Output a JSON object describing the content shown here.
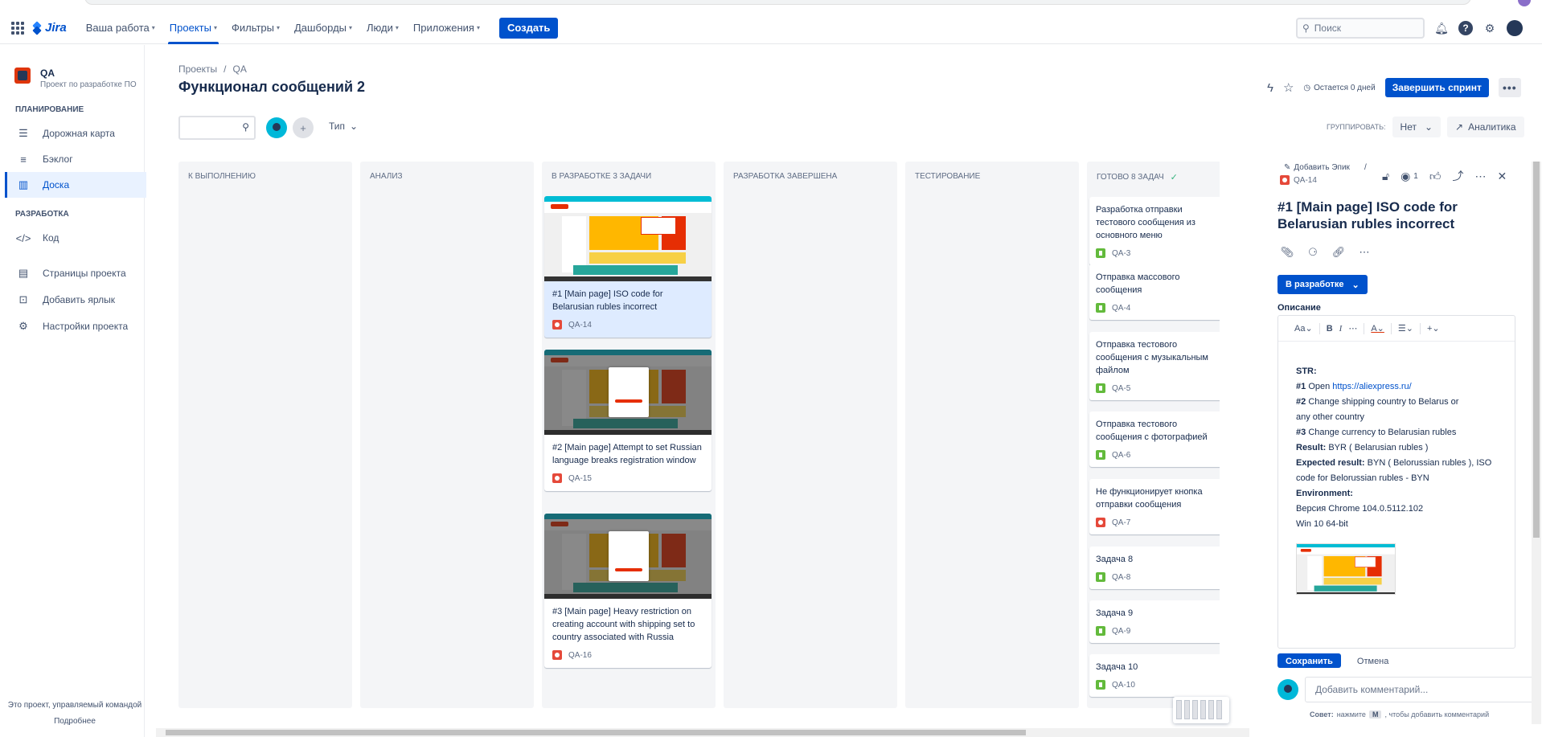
{
  "nav": {
    "logo": "Jira",
    "items": [
      {
        "label": "Ваша работа"
      },
      {
        "label": "Проекты"
      },
      {
        "label": "Фильтры"
      },
      {
        "label": "Дашборды"
      },
      {
        "label": "Люди"
      },
      {
        "label": "Приложения"
      }
    ],
    "create": "Создать",
    "search_placeholder": "Поиск"
  },
  "sidebar": {
    "project_name": "QA",
    "project_sub": "Проект по разработке ПО",
    "section_planning": "ПЛАНИРОВАНИЕ",
    "items": [
      {
        "label": "Дорожная карта"
      },
      {
        "label": "Бэклог"
      },
      {
        "label": "Доска"
      }
    ],
    "section_dev": "РАЗРАБОТКА",
    "code": "Код",
    "pages": "Страницы проекта",
    "add_shortcut": "Добавить ярлык",
    "settings": "Настройки проекта",
    "footer_note": "Это проект, управляемый командой",
    "footer_link": "Подробнее"
  },
  "header": {
    "breadcrumb_projects": "Проекты",
    "breadcrumb_sep": "/",
    "breadcrumb_qa": "QA",
    "title": "Функционал сообщений 2",
    "remaining": "Остается 0 дней",
    "complete_sprint": "Завершить спринт",
    "more": "•••"
  },
  "filters": {
    "type": "Тип",
    "groupby_label": "ГРУППИРОВАТЬ:",
    "groupby_value": "Нет",
    "analytics": "Аналитика"
  },
  "columns": [
    {
      "title": "К выполнению"
    },
    {
      "title": "Анализ"
    },
    {
      "title": "В разработке 3 задачи"
    },
    {
      "title": "Разработка завершена"
    },
    {
      "title": "Тестирование"
    },
    {
      "title": "Готово 8 задач"
    }
  ],
  "dev_cards": [
    {
      "text": "#1 [Main page] ISO code for Belarusian rubles incorrect",
      "key": "QA-14"
    },
    {
      "text": "#2 [Main page] Attempt to set Russian language breaks registration window",
      "key": "QA-15"
    },
    {
      "text": "#3 [Main page] Heavy restriction on creating account with shipping set to country associated with Russia",
      "key": "QA-16"
    }
  ],
  "done_cards": [
    {
      "text": "Разработка отправки тестового сообщения из основного меню",
      "key": "QA-3"
    },
    {
      "text": "Отправка массового сообщения",
      "key": "QA-4"
    },
    {
      "text": "Отправка тестового сообщения с музыкальным файлом",
      "key": "QA-5"
    },
    {
      "text": "Отправка тестового сообщения с фотографией",
      "key": "QA-6"
    },
    {
      "text": "Не функционирует кнопка отправки сообщения",
      "key": "QA-7"
    },
    {
      "text": "Задача 8",
      "key": "QA-8"
    },
    {
      "text": "Задача 9",
      "key": "QA-9"
    },
    {
      "text": "Задача 10",
      "key": "QA-10"
    }
  ],
  "detail": {
    "add_epic": "Добавить Эпик",
    "key": "QA-14",
    "watchers": "1",
    "title": "#1 [Main page] ISO code for Belarusian rubles incorrect",
    "status": "В разработке",
    "description_label": "Описание",
    "toolbar_text": "Aa",
    "str": "STR:",
    "step1_label": "#1",
    "step1_text": "Open",
    "step1_link": "https://aliexpress.ru/",
    "step2_label": "#2",
    "step2_text": "Change shipping country to Belarus or any other country",
    "step3_label": "#3",
    "step3_text": "Change currency to Belarusian rubles",
    "result_label": "Result:",
    "result_text": "BYR ( Belarusian rubles )",
    "expected_label": "Expected result:",
    "expected_text": "BYN ( Belorussian rubles ), ISO code for Belorussian rubles - BYN",
    "env_label": "Environment:",
    "env1": "Версия Chrome 104.0.5112.102",
    "env2": "Win 10 64-bit",
    "save": "Сохранить",
    "cancel": "Отмена",
    "comment_placeholder": "Добавить комментарий...",
    "tip_label": "Совет:",
    "tip_pre": "нажмите",
    "tip_key": "M",
    "tip_post": ", чтобы добавить комментарий"
  }
}
